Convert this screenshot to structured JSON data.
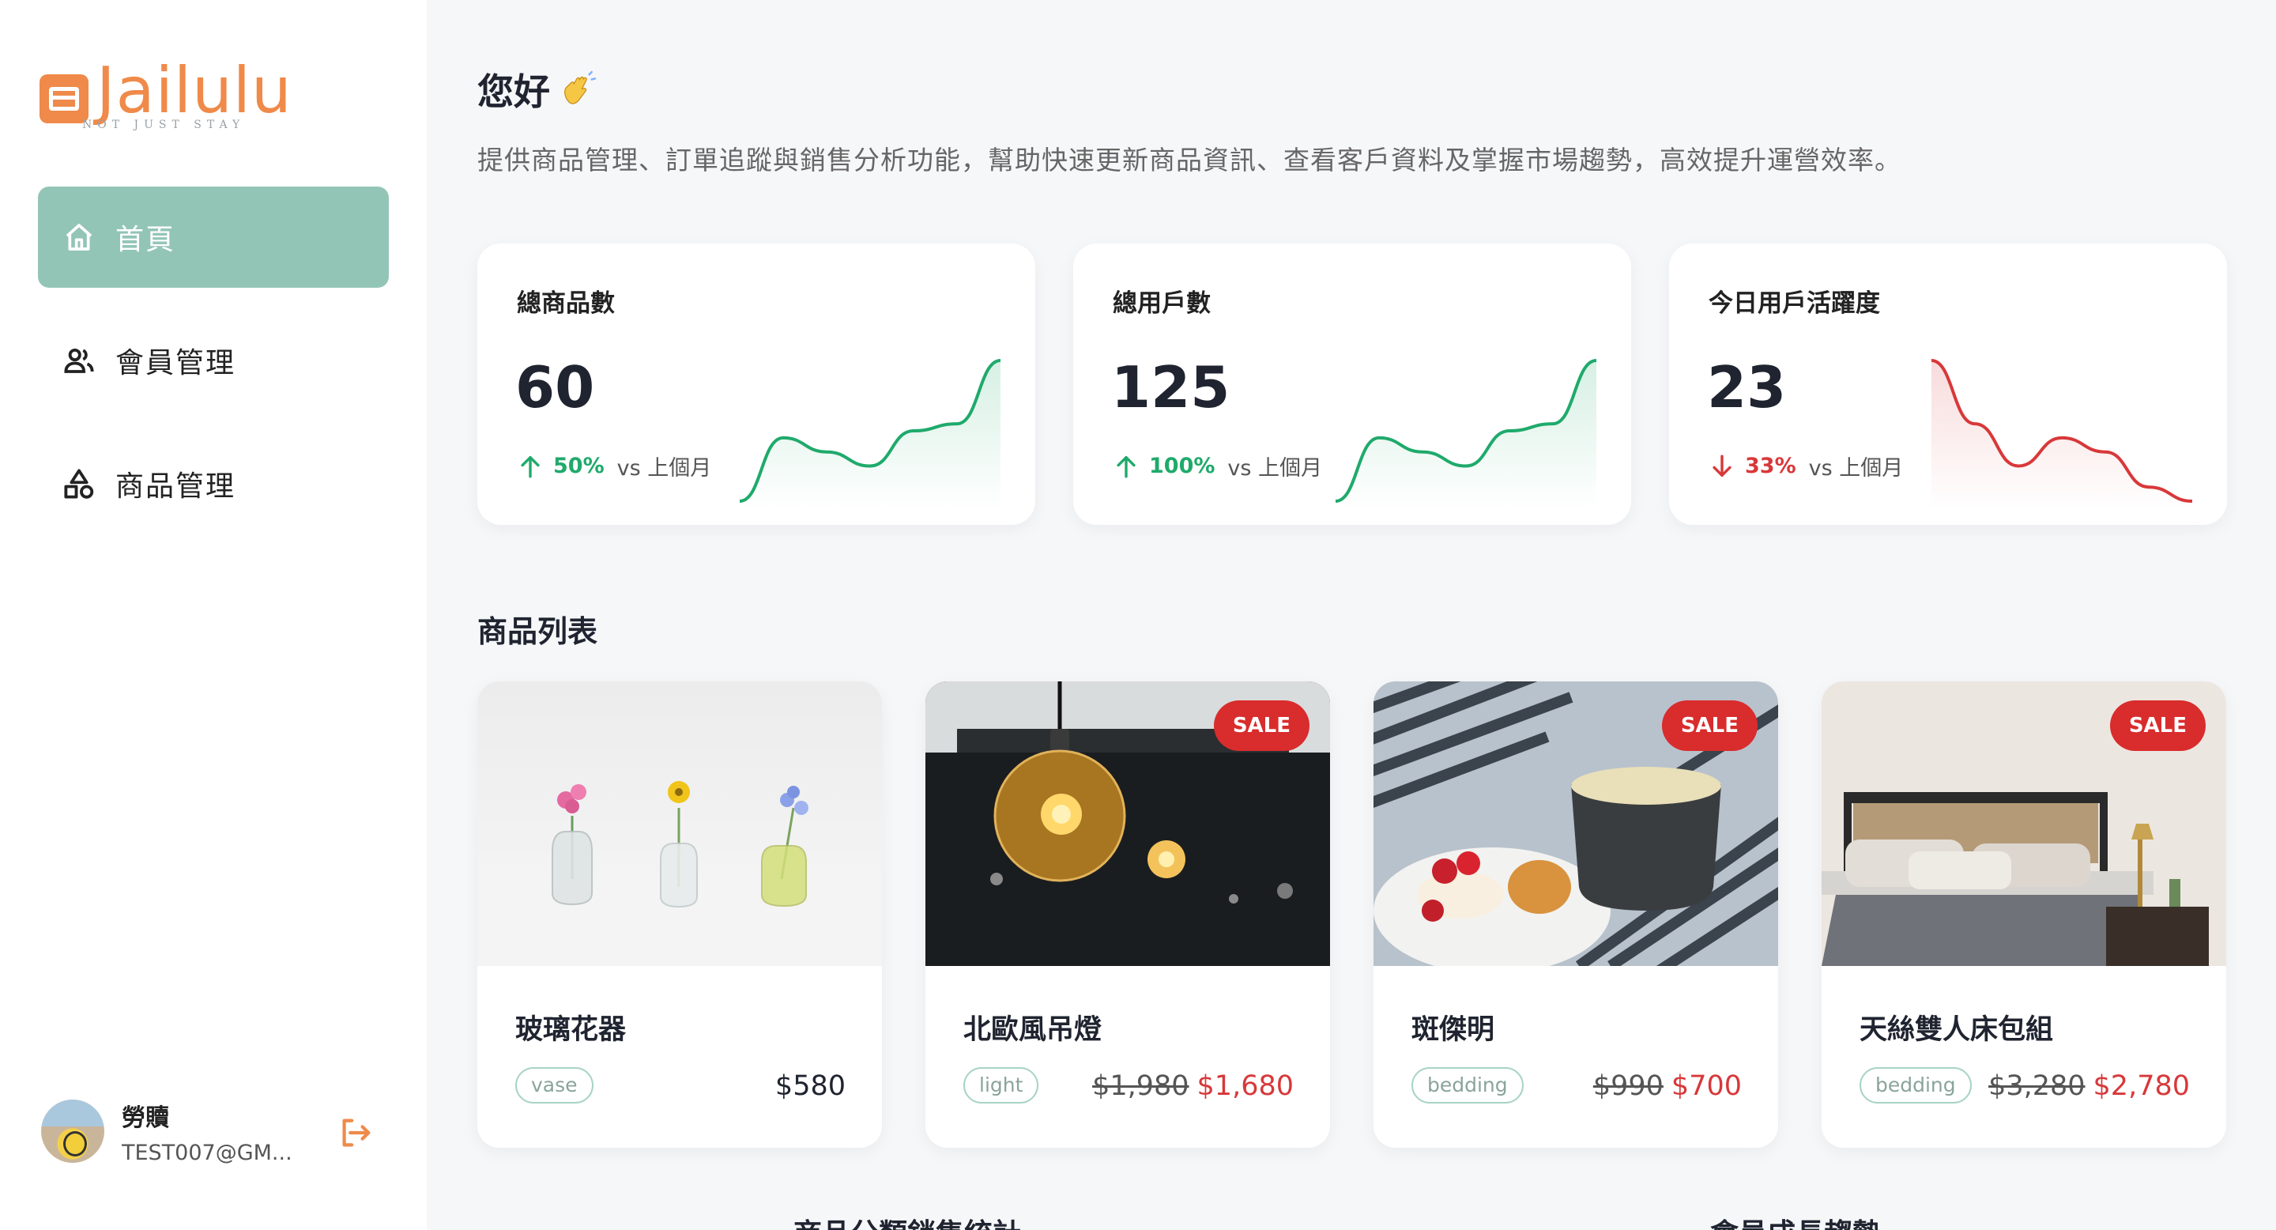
{
  "brand": {
    "name": "Jailulu",
    "tagline": "NOT JUST STAY",
    "accent": "#ef8a4a"
  },
  "sidebar": {
    "items": [
      {
        "label": "首頁",
        "icon": "home-icon",
        "active": true
      },
      {
        "label": "會員管理",
        "icon": "users-icon",
        "active": false
      },
      {
        "label": "商品管理",
        "icon": "shapes-icon",
        "active": false
      }
    ],
    "active_color": "#93c5b6"
  },
  "user": {
    "name": "勞贖",
    "email": "TEST007@GM...",
    "logout_icon": "logout-icon"
  },
  "header": {
    "greeting": "您好",
    "greeting_emoji": "waving-hand-icon",
    "subtitle": "提供商品管理、訂單追蹤與銷售分析功能，幫助快速更新商品資訊、查看客戶資料及掌握市場趨勢，高效提升運營效率。"
  },
  "stats": [
    {
      "title": "總商品數",
      "value": "60",
      "change": "50%",
      "direction": "up",
      "compare": "vs 上個月",
      "trend": [
        0,
        0.45,
        0.35,
        0.25,
        0.5,
        0.55,
        1
      ],
      "color": "#1faa6b"
    },
    {
      "title": "總用戶數",
      "value": "125",
      "change": "100%",
      "direction": "up",
      "compare": "vs 上個月",
      "trend": [
        0,
        0.45,
        0.35,
        0.25,
        0.5,
        0.55,
        1
      ],
      "color": "#1faa6b"
    },
    {
      "title": "今日用戶活躍度",
      "value": "23",
      "change": "33%",
      "direction": "down",
      "compare": "vs 上個月",
      "trend": [
        1,
        0.55,
        0.25,
        0.45,
        0.35,
        0.1,
        0
      ],
      "color": "#d8383a"
    }
  ],
  "products_section": {
    "title": "商品列表"
  },
  "products": [
    {
      "name": "玻璃花器",
      "tag": "vase",
      "price": "$580",
      "sale": false,
      "old_price": "",
      "image": "glass-vases-photo"
    },
    {
      "name": "北歐風吊燈",
      "tag": "light",
      "price": "$1,680",
      "sale": true,
      "sale_label": "SALE",
      "old_price": "$1,980",
      "image": "pendant-bulb-photo"
    },
    {
      "name": "斑傑明",
      "tag": "bedding",
      "price": "$700",
      "sale": true,
      "sale_label": "SALE",
      "old_price": "$990",
      "image": "coffee-cake-photo"
    },
    {
      "name": "天絲雙人床包組",
      "tag": "bedding",
      "price": "$2,780",
      "sale": true,
      "sale_label": "SALE",
      "old_price": "$3,280",
      "image": "bedroom-photo"
    }
  ],
  "bottom_sections": {
    "left_title": "商品分類銷售統計",
    "right_title": "會員成長趨勢"
  }
}
